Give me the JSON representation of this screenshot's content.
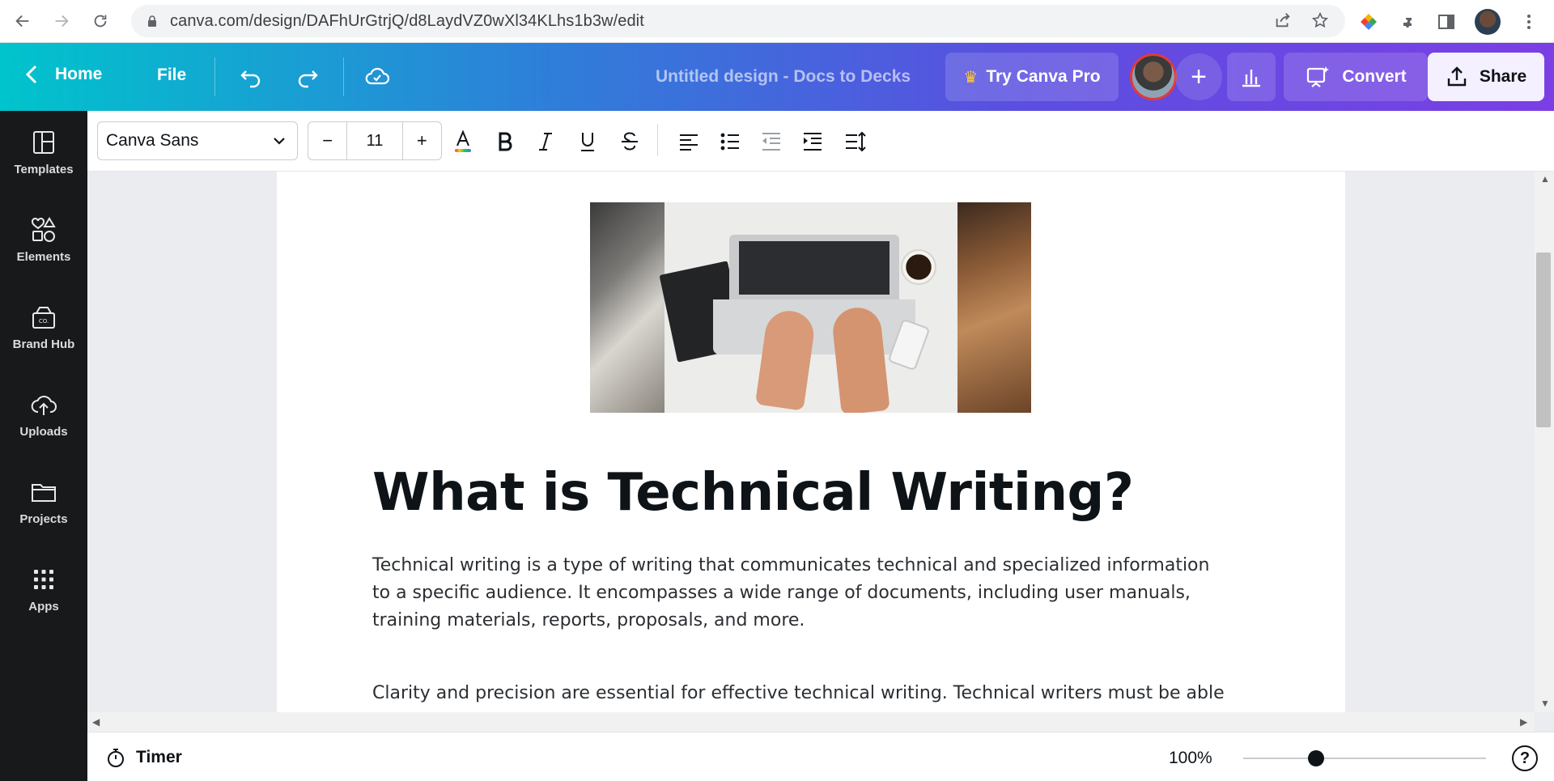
{
  "browser": {
    "url": "canva.com/design/DAFhUrGtrjQ/d8LaydVZ0wXl34KLhs1b3w/edit"
  },
  "header": {
    "home_label": "Home",
    "file_label": "File",
    "title": "Untitled design - Docs to Decks",
    "try_pro_label": "Try Canva Pro",
    "add_label": "+",
    "convert_label": "Convert",
    "share_label": "Share"
  },
  "sidebar": {
    "items": [
      {
        "label": "Templates",
        "icon": "templates-icon"
      },
      {
        "label": "Elements",
        "icon": "elements-icon"
      },
      {
        "label": "Brand Hub",
        "icon": "brand-hub-icon"
      },
      {
        "label": "Uploads",
        "icon": "uploads-icon"
      },
      {
        "label": "Projects",
        "icon": "projects-icon"
      },
      {
        "label": "Apps",
        "icon": "apps-icon"
      }
    ]
  },
  "toolbar": {
    "font": "Canva Sans",
    "size_minus": "−",
    "size": "11",
    "size_plus": "+"
  },
  "document": {
    "title": "What is Technical Writing?",
    "paragraphs": [
      "Technical writing is a type of writing that communicates technical and specialized information to a specific audience. It encompasses a wide range of documents, including user manuals, training materials, reports, proposals, and more.",
      "Clarity and precision are essential for effective technical writing. Technical writers must be able to"
    ]
  },
  "footer": {
    "timer_label": "Timer",
    "zoom": "100%",
    "help": "?"
  }
}
